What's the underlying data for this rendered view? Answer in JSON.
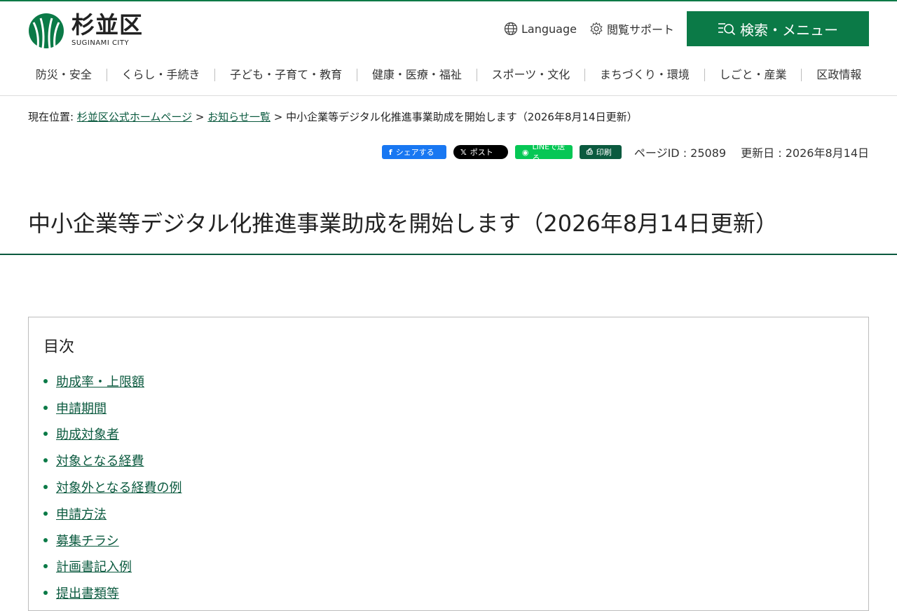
{
  "header": {
    "logo_ja": "杉並区",
    "logo_en": "SUGINAMI CITY",
    "language_label": "Language",
    "support_label": "閲覧サポート",
    "search_menu_label": "検索・メニュー",
    "accent_color": "#0b7a47"
  },
  "global_nav": [
    {
      "label": "防災・安全"
    },
    {
      "label": "くらし・手続き"
    },
    {
      "label": "子ども・子育て・教育"
    },
    {
      "label": "健康・医療・福祉"
    },
    {
      "label": "スポーツ・文化"
    },
    {
      "label": "まちづくり・環境"
    },
    {
      "label": "しごと・産業"
    },
    {
      "label": "区政情報"
    }
  ],
  "breadcrumb": {
    "prefix": "現在位置:",
    "home": "杉並区公式ホームページ",
    "sep": ">",
    "parent": "お知らせ一覧",
    "current": "中小企業等デジタル化推進事業助成を開始します（2026年8月14日更新）"
  },
  "share": {
    "facebook": "シェアする",
    "x": "ポスト",
    "line": "LINEで送る",
    "print": "印刷"
  },
  "page_meta": {
    "page_id": "ページID : 25089",
    "updated": "更新日 : 2026年8月14日"
  },
  "page_title": "中小企業等デジタル化推進事業助成を開始します（2026年8月14日更新）",
  "toc": {
    "title": "目次",
    "items": [
      {
        "label": "助成率・上限額"
      },
      {
        "label": "申請期間"
      },
      {
        "label": "助成対象者"
      },
      {
        "label": "対象となる経費"
      },
      {
        "label": "対象外となる経費の例"
      },
      {
        "label": "申請方法"
      },
      {
        "label": "募集チラシ"
      },
      {
        "label": "計画書記入例"
      },
      {
        "label": "提出書類等"
      }
    ]
  }
}
